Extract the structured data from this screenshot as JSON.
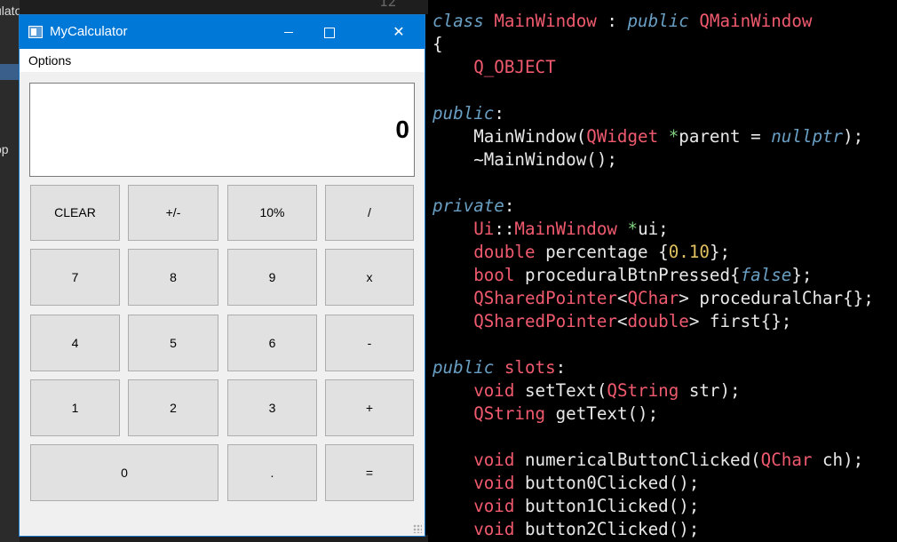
{
  "ide": {
    "left_fragment_1": "ulator",
    "left_fragment_2": "op",
    "line_number": "12"
  },
  "window": {
    "title": "MyCalculator",
    "close_glyph": "✕"
  },
  "menu": {
    "options": "Options"
  },
  "display": {
    "value": "0"
  },
  "buttons": {
    "clear": "CLEAR",
    "sign": "+/-",
    "percent": "10%",
    "divide": "/",
    "seven": "7",
    "eight": "8",
    "nine": "9",
    "multiply": "x",
    "four": "4",
    "five": "5",
    "six": "6",
    "minus": "-",
    "one": "1",
    "two": "2",
    "three": "3",
    "plus": "+",
    "zero": "0",
    "dot": ".",
    "equals": "="
  },
  "code": {
    "l1": {
      "a": "class",
      "b": " MainWindow",
      "c": " : ",
      "d": "public",
      "e": " QMainWindow"
    },
    "l2": "{",
    "l3": "    Q_OBJECT",
    "l5": {
      "a": "public",
      "b": ":"
    },
    "l6": {
      "a": "    MainWindow(",
      "b": "QWidget",
      "c": " *",
      "d": "parent = ",
      "e": "nullptr",
      "f": ");"
    },
    "l7": "    ~MainWindow();",
    "l9": {
      "a": "private",
      "b": ":"
    },
    "l10": {
      "a": "    Ui",
      "b": "::",
      "c": "MainWindow",
      "d": " *",
      "e": "ui;"
    },
    "l11": {
      "a": "    double",
      "b": " percentage {",
      "c": "0.10",
      "d": "};"
    },
    "l12": {
      "a": "    bool",
      "b": " proceduralBtnPressed{",
      "c": "false",
      "d": "};"
    },
    "l13": {
      "a": "    QSharedPointer",
      "b": "<",
      "c": "QChar",
      "d": "> proceduralChar{};"
    },
    "l14": {
      "a": "    QSharedPointer",
      "b": "<",
      "c": "double",
      "d": "> first{};"
    },
    "l16": {
      "a": "public",
      "b": " slots",
      "c": ":"
    },
    "l17": {
      "a": "    void",
      "b": " setText(",
      "c": "QString",
      "d": " str);"
    },
    "l18": {
      "a": "    QString",
      "b": " getText();"
    },
    "l20": {
      "a": "    void",
      "b": " numericalButtonClicked(",
      "c": "QChar",
      "d": " ch);"
    },
    "l21": {
      "a": "    void",
      "b": " button0Clicked();"
    },
    "l22": {
      "a": "    void",
      "b": " button1Clicked();"
    },
    "l23": {
      "a": "    void",
      "b": " button2Clicked();"
    }
  }
}
